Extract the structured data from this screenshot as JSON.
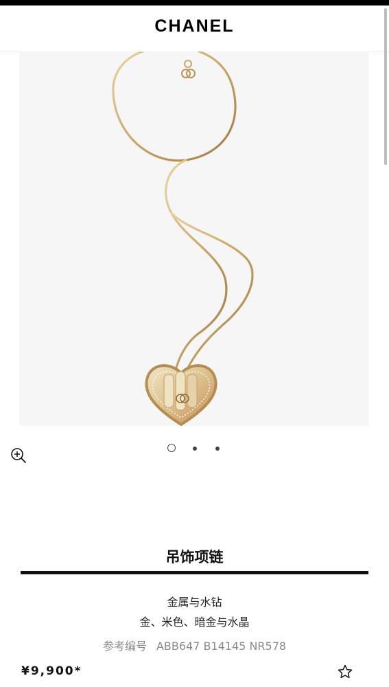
{
  "header": {
    "brand": "CHANEL"
  },
  "gallery": {
    "zoom_icon": "zoom-in-icon",
    "slides": 3,
    "current_slide": 1
  },
  "product": {
    "name": "吊饰项链",
    "material": "金属与水钻",
    "color": "金、米色、暗金与水晶",
    "reference_label": "参考编号",
    "reference_code": "ABB647 B14145 NR578",
    "price": "¥9,900*",
    "wishlist_icon": "star-outline-icon"
  },
  "colors": {
    "text": "#111111",
    "muted": "#8a8a8a",
    "image_bg": "#f6f6f6",
    "gold": "#c9a86a"
  }
}
